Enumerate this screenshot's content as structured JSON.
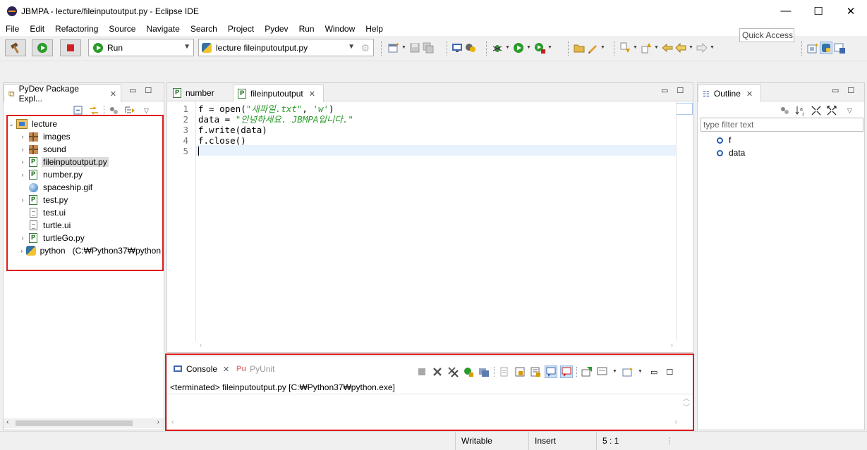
{
  "window": {
    "title": "JBMPA - lecture/fileinputoutput.py - Eclipse IDE",
    "minimize": "—",
    "maximize": "☐",
    "close": "✕"
  },
  "menu": [
    "File",
    "Edit",
    "Refactoring",
    "Source",
    "Navigate",
    "Search",
    "Project",
    "Pydev",
    "Run",
    "Window",
    "Help"
  ],
  "toolbar": {
    "run_config": "Run",
    "launch_target": "lecture fileinputoutput.py",
    "quick_access_placeholder": "Quick Access"
  },
  "package_explorer": {
    "tab_label": "PyDev Package Expl...",
    "project": "lecture",
    "items": [
      {
        "label": "images",
        "icon": "package-icon",
        "expandable": true
      },
      {
        "label": "sound",
        "icon": "package-icon",
        "expandable": true
      },
      {
        "label": "fileinputoutput.py",
        "icon": "python-file-icon",
        "expandable": true,
        "selected": true
      },
      {
        "label": "number.py",
        "icon": "python-file-icon",
        "expandable": true
      },
      {
        "label": "spaceship.gif",
        "icon": "image-file-icon",
        "expandable": false
      },
      {
        "label": "test.py",
        "icon": "python-file-icon",
        "expandable": true
      },
      {
        "label": "test.ui",
        "icon": "text-file-icon",
        "expandable": false
      },
      {
        "label": "turtle.ui",
        "icon": "text-file-icon",
        "expandable": false
      },
      {
        "label": "turtleGo.py",
        "icon": "python-file-icon",
        "expandable": true
      },
      {
        "label": "python   (C:₩Python37₩python",
        "icon": "python-interpreter-icon",
        "expandable": true
      }
    ]
  },
  "editor": {
    "tabs": [
      {
        "label": "number",
        "active": false
      },
      {
        "label": "fileinputoutput",
        "active": true
      }
    ],
    "lines": [
      {
        "num": "1",
        "pre": "f = open(",
        "s1": "\"새파일.txt\"",
        "mid": ", ",
        "s2": "'w'",
        "post": ")"
      },
      {
        "num": "2",
        "pre": "data = ",
        "s1": "\"안녕하세요. JBMPA입니다.\"",
        "mid": "",
        "s2": "",
        "post": ""
      },
      {
        "num": "3",
        "pre": "f.write(data)",
        "s1": "",
        "mid": "",
        "s2": "",
        "post": ""
      },
      {
        "num": "4",
        "pre": "f.close()",
        "s1": "",
        "mid": "",
        "s2": "",
        "post": ""
      },
      {
        "num": "5",
        "pre": "",
        "s1": "",
        "mid": "",
        "s2": "",
        "post": ""
      }
    ]
  },
  "outline": {
    "tab_label": "Outline",
    "filter_placeholder": "type filter text",
    "items": [
      "f",
      "data"
    ]
  },
  "console": {
    "tab_label": "Console",
    "pyunit_label": "PyUnit",
    "output": "<terminated> fileinputoutput.py [C:₩Python37₩python.exe]"
  },
  "status": {
    "writable": "Writable",
    "insert": "Insert",
    "position": "5 : 1"
  },
  "colors": {
    "highlight": "#e11b1b",
    "string": "#2a9a2a"
  }
}
